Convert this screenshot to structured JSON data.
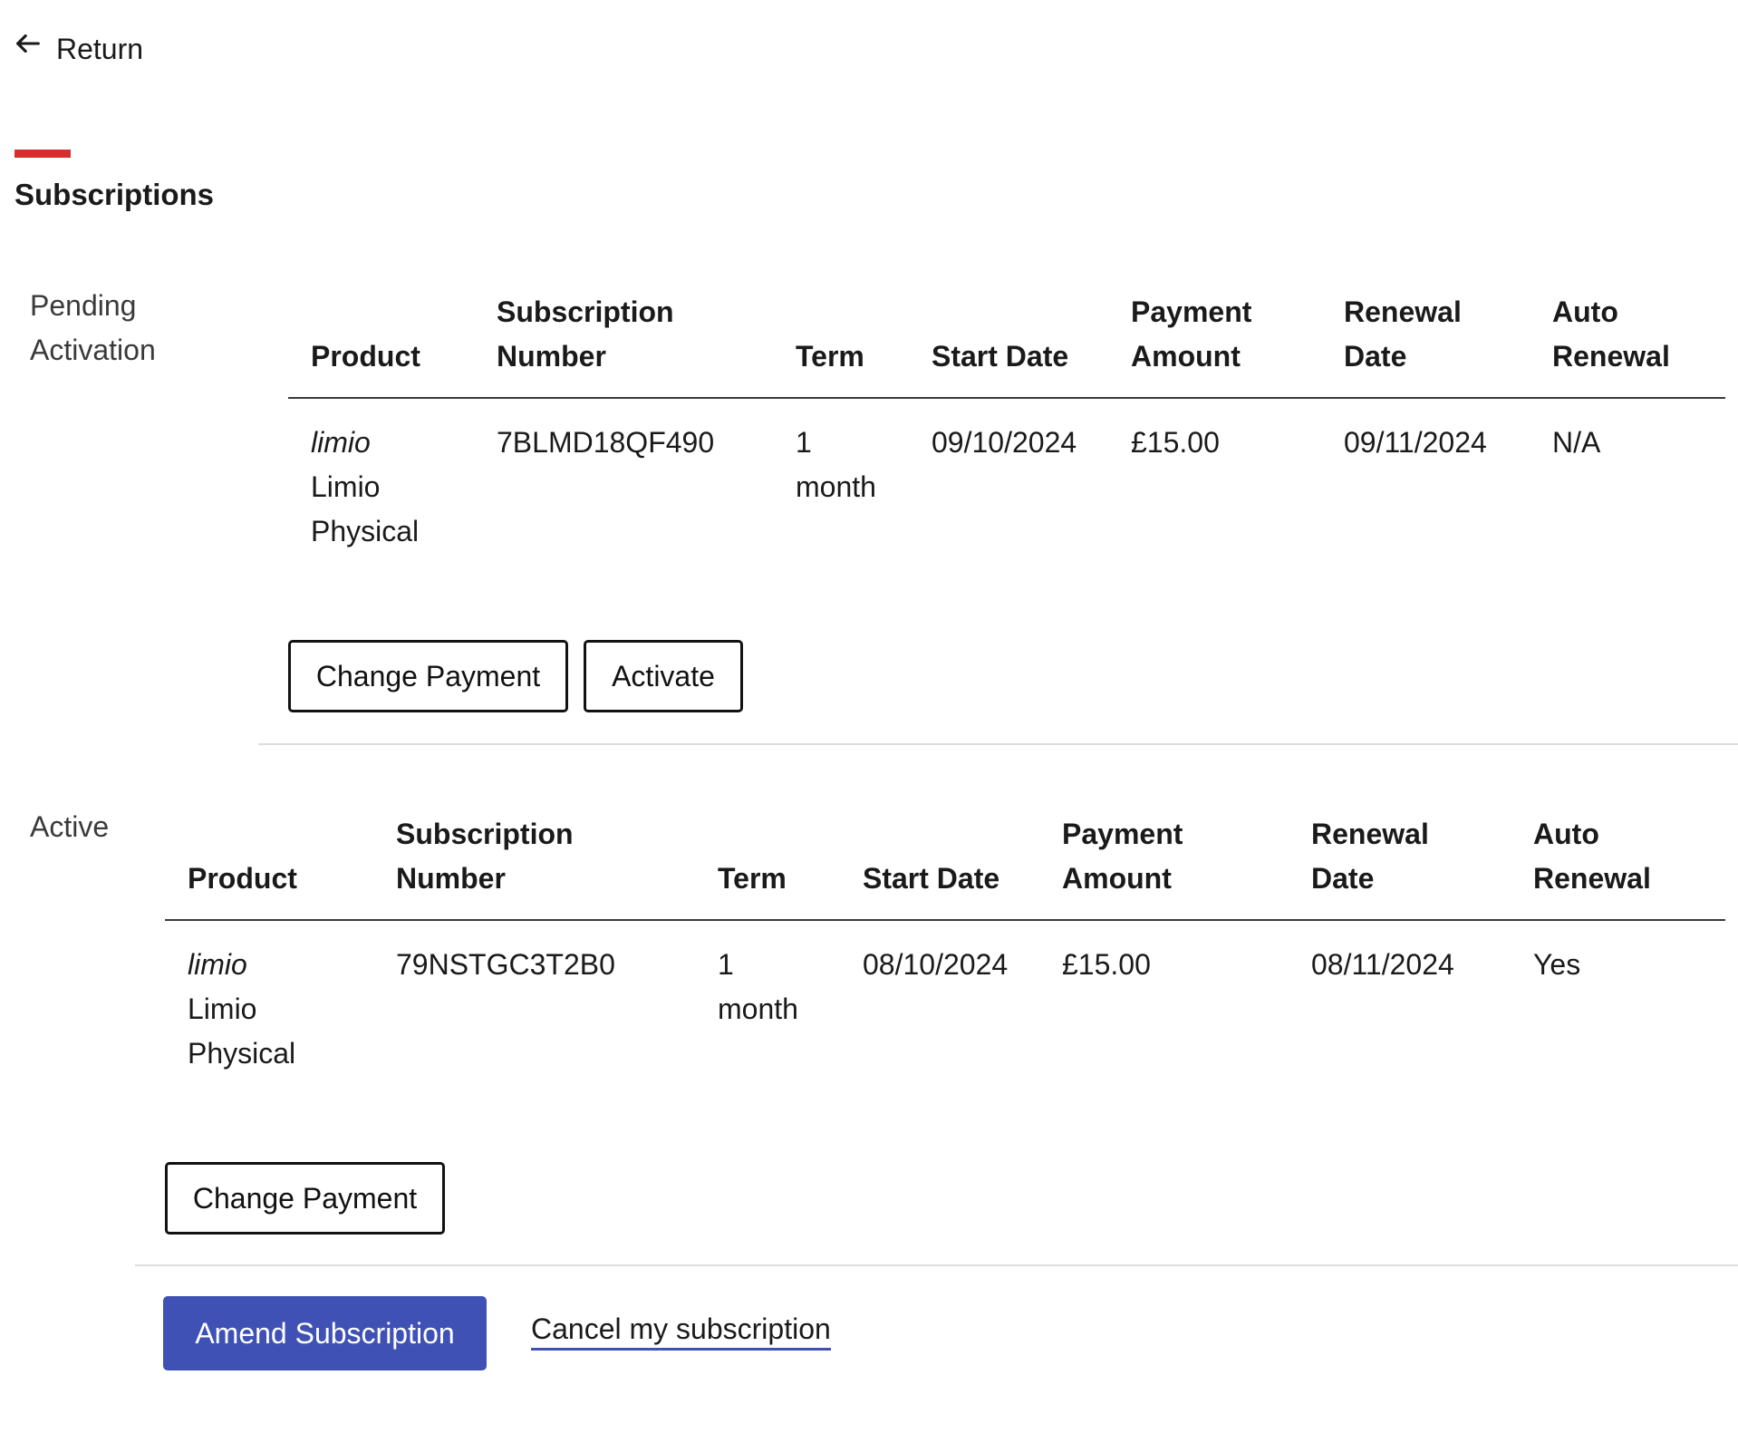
{
  "nav": {
    "return_label": "Return"
  },
  "page": {
    "title": "Subscriptions"
  },
  "colors": {
    "accent": "#d32f2f",
    "primary_button": "#3f51b5"
  },
  "table_headers": {
    "product": "Product",
    "subscription_number_line1": "Subscription",
    "subscription_number_line2": "Number",
    "term": "Term",
    "start_date": "Start Date",
    "payment_amount_line1": "Payment",
    "payment_amount_line2": "Amount",
    "renewal_date_line1": "Renewal",
    "renewal_date_line2": "Date",
    "auto_renewal_line1": "Auto",
    "auto_renewal_line2": "Renewal"
  },
  "pending": {
    "label_line1": "Pending",
    "label_line2": "Activation",
    "row": {
      "product_brand": "limio",
      "product_name_line1": "Limio",
      "product_name_line2": "Physical",
      "subscription_number": "7BLMD18QF490",
      "term_line1": "1",
      "term_line2": "month",
      "start_date": "09/10/2024",
      "payment_amount": "£15.00",
      "renewal_date": "09/11/2024",
      "auto_renewal": "N/A"
    },
    "change_payment_label": "Change Payment",
    "activate_label": "Activate"
  },
  "active": {
    "label": "Active",
    "row": {
      "product_brand": "limio",
      "product_name_line1": "Limio",
      "product_name_line2": "Physical",
      "subscription_number": "79NSTGC3T2B0",
      "term_line1": "1",
      "term_line2": "month",
      "start_date": "08/10/2024",
      "payment_amount": "£15.00",
      "renewal_date": "08/11/2024",
      "auto_renewal": "Yes"
    },
    "change_payment_label": "Change Payment"
  },
  "actions": {
    "amend_label": "Amend Subscription",
    "cancel_label": "Cancel my subscription"
  },
  "icons": {
    "return": "arrow-left-icon"
  }
}
